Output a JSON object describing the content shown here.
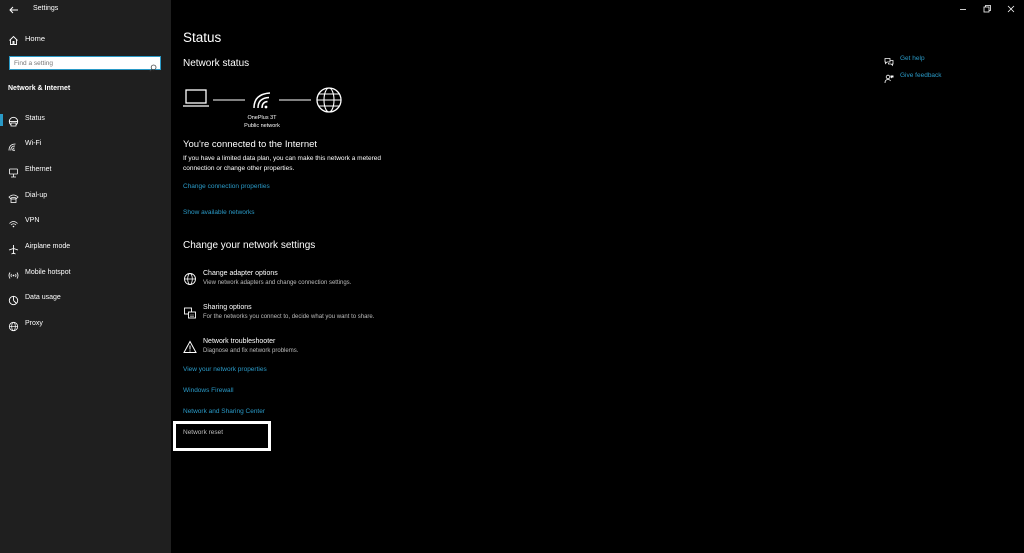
{
  "app": {
    "title": "Settings"
  },
  "sidebar": {
    "home_label": "Home",
    "search_placeholder": "Find a setting",
    "section_title": "Network & Internet",
    "items": [
      {
        "label": "Status",
        "icon": "status-icon"
      },
      {
        "label": "Wi-Fi",
        "icon": "wifi-icon"
      },
      {
        "label": "Ethernet",
        "icon": "ethernet-icon"
      },
      {
        "label": "Dial-up",
        "icon": "dialup-icon"
      },
      {
        "label": "VPN",
        "icon": "vpn-icon"
      },
      {
        "label": "Airplane mode",
        "icon": "airplane-icon"
      },
      {
        "label": "Mobile hotspot",
        "icon": "hotspot-icon"
      },
      {
        "label": "Data usage",
        "icon": "data-usage-icon"
      },
      {
        "label": "Proxy",
        "icon": "proxy-icon"
      }
    ],
    "selected": "Status"
  },
  "main": {
    "title": "Status",
    "network_status_heading": "Network status",
    "network_name": "OnePlus 3T",
    "network_type": "Public network",
    "connected_title": "You're connected to the Internet",
    "connected_desc": "If you have a limited data plan, you can make this network a metered connection or change other properties.",
    "change_connection_link": "Change connection properties",
    "show_networks_link": "Show available networks",
    "change_settings_heading": "Change your network settings",
    "options": [
      {
        "title": "Change adapter options",
        "desc": "View network adapters and change connection settings.",
        "icon": "adapter-icon"
      },
      {
        "title": "Sharing options",
        "desc": "For the networks you connect to, decide what you want to share.",
        "icon": "sharing-icon"
      },
      {
        "title": "Network troubleshooter",
        "desc": "Diagnose and fix network problems.",
        "icon": "warning-icon"
      }
    ],
    "links": {
      "view_properties": "View your network properties",
      "firewall": "Windows Firewall",
      "sharing_center": "Network and Sharing Center",
      "network_reset": "Network reset"
    }
  },
  "help": {
    "get_help": "Get help",
    "give_feedback": "Give feedback"
  },
  "colors": {
    "accent": "#2a9ac7",
    "sidebar_bg": "#1f1f1f",
    "main_bg": "#000000"
  }
}
